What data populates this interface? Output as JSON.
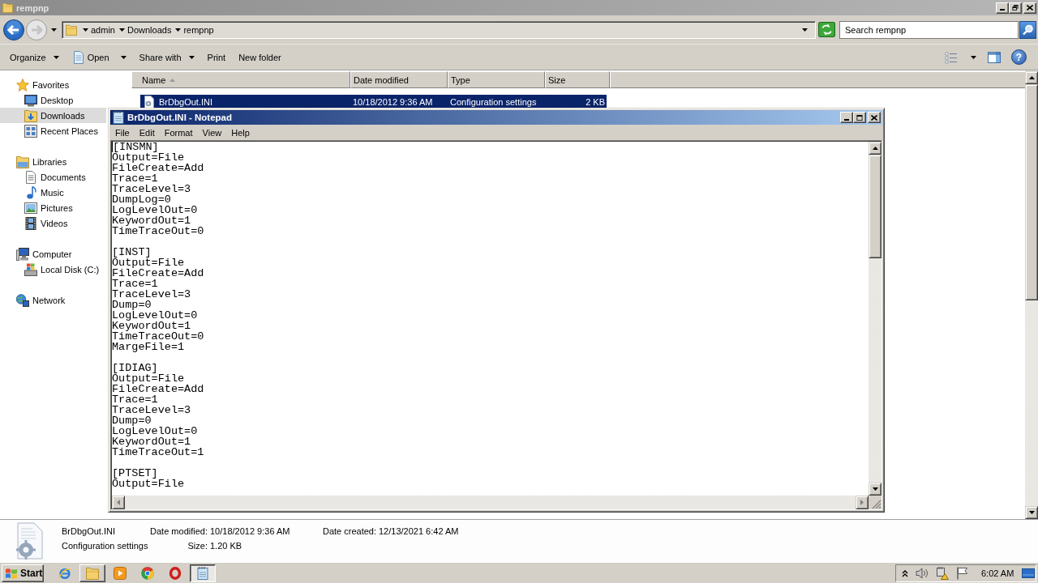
{
  "explorer": {
    "title": "rempnp",
    "breadcrumb": [
      "admin",
      "Downloads",
      "rempnp"
    ],
    "search": {
      "placeholder": "Search rempnp"
    },
    "toolbar": [
      {
        "label": "Organize",
        "dropdown": true
      },
      {
        "label": "Open",
        "dropdown": true
      },
      {
        "label": "Share with",
        "dropdown": true
      },
      {
        "label": "Print",
        "dropdown": false
      },
      {
        "label": "New folder",
        "dropdown": false
      }
    ],
    "help_label": "?",
    "sidebar": [
      {
        "label": "Favorites",
        "selected": false,
        "children": [
          {
            "label": "Desktop",
            "selected": false
          },
          {
            "label": "Downloads",
            "selected": true
          },
          {
            "label": "Recent Places",
            "selected": false
          }
        ]
      },
      {
        "label": "Libraries",
        "selected": false,
        "children": [
          {
            "label": "Documents",
            "selected": false
          },
          {
            "label": "Music",
            "selected": false
          },
          {
            "label": "Pictures",
            "selected": false
          },
          {
            "label": "Videos",
            "selected": false
          }
        ]
      },
      {
        "label": "Computer",
        "selected": false,
        "children": [
          {
            "label": "Local Disk (C:)",
            "selected": false
          }
        ]
      },
      {
        "label": "Network",
        "selected": false
      }
    ],
    "table": {
      "columns": [
        {
          "label": "Name",
          "sorted": true
        },
        {
          "label": "Date modified",
          "sorted": false
        },
        {
          "label": "Type",
          "sorted": false
        },
        {
          "label": "Size",
          "sorted": false
        }
      ],
      "rows": [
        {
          "cells": [
            "BrDbgOut.INI",
            "10/18/2012 9:36 AM",
            "Configuration settings",
            "2 KB"
          ],
          "selected": true
        }
      ]
    },
    "details": {
      "name": "BrDbgOut.INI",
      "type": "Configuration settings",
      "fields": [
        {
          "label": "Date modified:",
          "value": "10/18/2012 9:36 AM"
        },
        {
          "label": "Size:",
          "value": "1.20 KB"
        },
        {
          "label": "Date created:",
          "value": "12/13/2021 6:42 AM"
        }
      ]
    }
  },
  "notepad": {
    "title": "BrDbgOut.INI - Notepad",
    "menu": [
      "File",
      "Edit",
      "Format",
      "View",
      "Help"
    ],
    "text": "[INSMN]\nOutput=File\nFileCreate=Add\nTrace=1\nTraceLevel=3\nDumpLog=0\nLogLevelOut=0\nKeywordOut=1\nTimeTraceOut=0\n\n[INST]\nOutput=File\nFileCreate=Add\nTrace=1\nTraceLevel=3\nDump=0\nLogLevelOut=0\nKeywordOut=1\nTimeTraceOut=0\nMargeFile=1\n\n[IDIAG]\nOutput=File\nFileCreate=Add\nTrace=1\nTraceLevel=3\nDump=0\nLogLevelOut=0\nKeywordOut=1\nTimeTraceOut=1\n\n[PTSET]\nOutput=File"
  },
  "taskbar": {
    "start_label": "Start",
    "apps": [
      {
        "kind": "launcher",
        "selected": false
      },
      {
        "kind": "window",
        "selected": false
      },
      {
        "kind": "launcher",
        "selected": false
      },
      {
        "kind": "launcher",
        "selected": false
      },
      {
        "kind": "launcher",
        "selected": false
      },
      {
        "kind": "window",
        "selected": true
      }
    ],
    "clock": "6:02 AM"
  }
}
